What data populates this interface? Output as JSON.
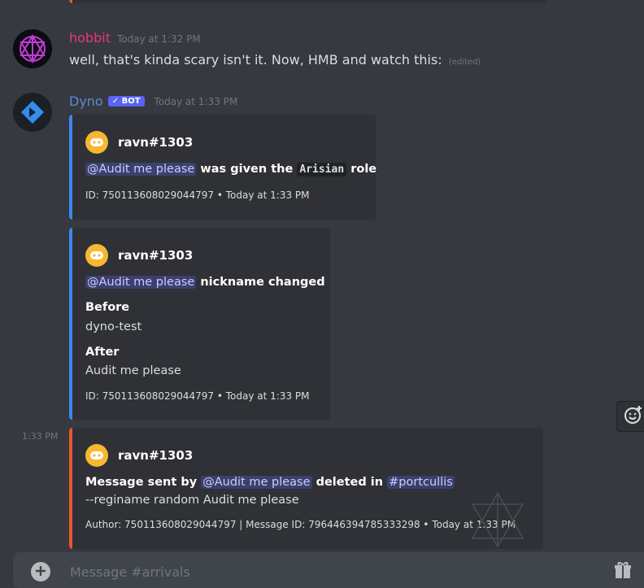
{
  "messages": [
    {
      "author": "hobbit",
      "author_color": "#e83878",
      "timestamp": "Today at 1:32 PM",
      "text": "well, that's kinda scary isn't it.  Now, HMB and watch this:",
      "edited_label": "(edited)"
    },
    {
      "author": "Dyno",
      "author_color": "#5a8bd6",
      "bot_badge": "✓ BOT",
      "timestamp": "Today at 1:33 PM"
    }
  ],
  "embeds": [
    {
      "author": "ravn#1303",
      "mention": "@Audit me please",
      "text_a": " was given the ",
      "role": "Arisian",
      "text_b": " role",
      "footer": "ID: 750113608029044797 • Today at 1:33 PM"
    },
    {
      "author": "ravn#1303",
      "mention": "@Audit me please",
      "text_a": " nickname changed",
      "field1_name": "Before",
      "field1_value": "dyno-test",
      "field2_name": "After",
      "field2_value": "Audit me please",
      "footer": "ID: 750113608029044797 • Today at 1:33 PM"
    },
    {
      "author": "ravn#1303",
      "text_a": "Message sent by ",
      "mention": "@Audit me please",
      "text_b": " deleted in ",
      "channel": "#portcullis",
      "content": "--reginame random Audit me please",
      "footer": "Author: 750113608029044797 | Message ID: 796446394785333298 • Today at 1:33 PM"
    }
  ],
  "hover_time": "1:33 PM",
  "composer": {
    "placeholder": "Message #arrivals"
  },
  "icons": [
    "hobbit-avatar-icon",
    "dyno-avatar-icon",
    "discord-logo-icon",
    "add-reaction-icon",
    "plus-circle-icon",
    "gift-icon"
  ]
}
